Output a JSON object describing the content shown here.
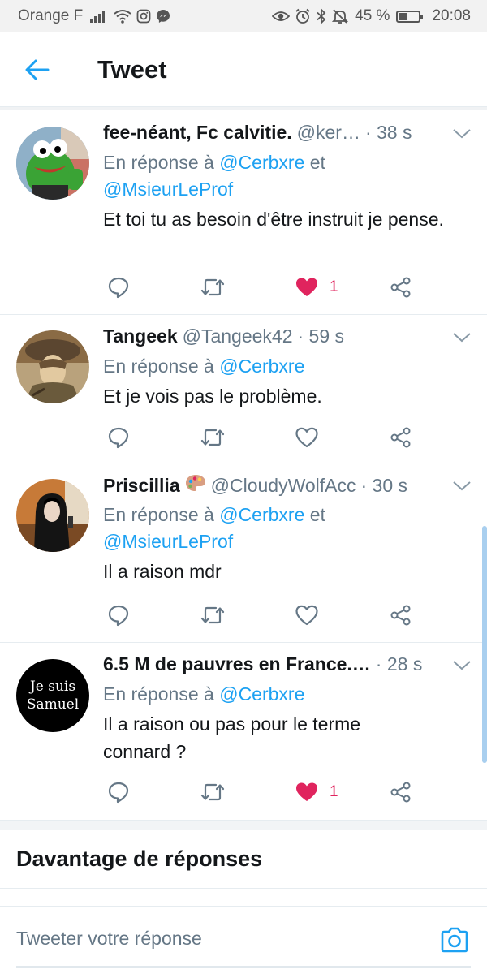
{
  "status_bar": {
    "carrier": "Orange F",
    "battery_percent": "45 %",
    "battery_level": 0.45,
    "time": "20:08",
    "icons_left": [
      "signal-icon",
      "wifi-icon",
      "instagram-icon",
      "messenger-icon"
    ],
    "icons_right": [
      "eye-icon",
      "alarm-icon",
      "bluetooth-icon",
      "mute-icon",
      "battery-icon"
    ]
  },
  "header": {
    "title": "Tweet",
    "back_icon": "back-arrow-icon"
  },
  "colors": {
    "accent": "#1da1f2",
    "like": "#e0245e",
    "muted": "#657786",
    "text": "#14171a"
  },
  "tweets": [
    {
      "name": "fee-néant, Fc calvitie.",
      "handle": "@ker…",
      "time": "· 38 s",
      "reply_prefix": "En réponse à ",
      "mentions": [
        "@Cerbxre",
        "@MsieurLeProf"
      ],
      "reply_joiner": " et ",
      "text": "Et toi tu as besoin d'être instruit je pense.",
      "liked": true,
      "like_count": "1"
    },
    {
      "name": "Tangeek",
      "handle": "@Tangeek42",
      "time": "· 59 s",
      "reply_prefix": "En réponse à ",
      "mentions": [
        "@Cerbxre"
      ],
      "text": "Et je vois pas le problème.",
      "liked": false,
      "like_count": ""
    },
    {
      "name": "Priscillia",
      "name_emoji": "palette-emoji",
      "handle": "@CloudyWolfAcc",
      "time": "· 30 s",
      "reply_prefix": "En réponse à ",
      "mentions": [
        "@Cerbxre",
        "@MsieurLeProf"
      ],
      "reply_joiner": " et ",
      "text": "Il a raison mdr",
      "liked": false,
      "like_count": ""
    },
    {
      "name": "6.5 M de pauvres en France.…",
      "handle": "",
      "time": "· 28 s",
      "avatar_text": [
        "Je suis",
        "Samuel"
      ],
      "reply_prefix": "En réponse à ",
      "mentions": [
        "@Cerbxre"
      ],
      "text": "Il a raison ou pas pour le terme connard ?",
      "liked": true,
      "like_count": "1"
    }
  ],
  "more_replies": {
    "title": "Davantage de réponses"
  },
  "compose": {
    "placeholder": "Tweeter votre réponse",
    "camera_icon": "camera-icon"
  }
}
